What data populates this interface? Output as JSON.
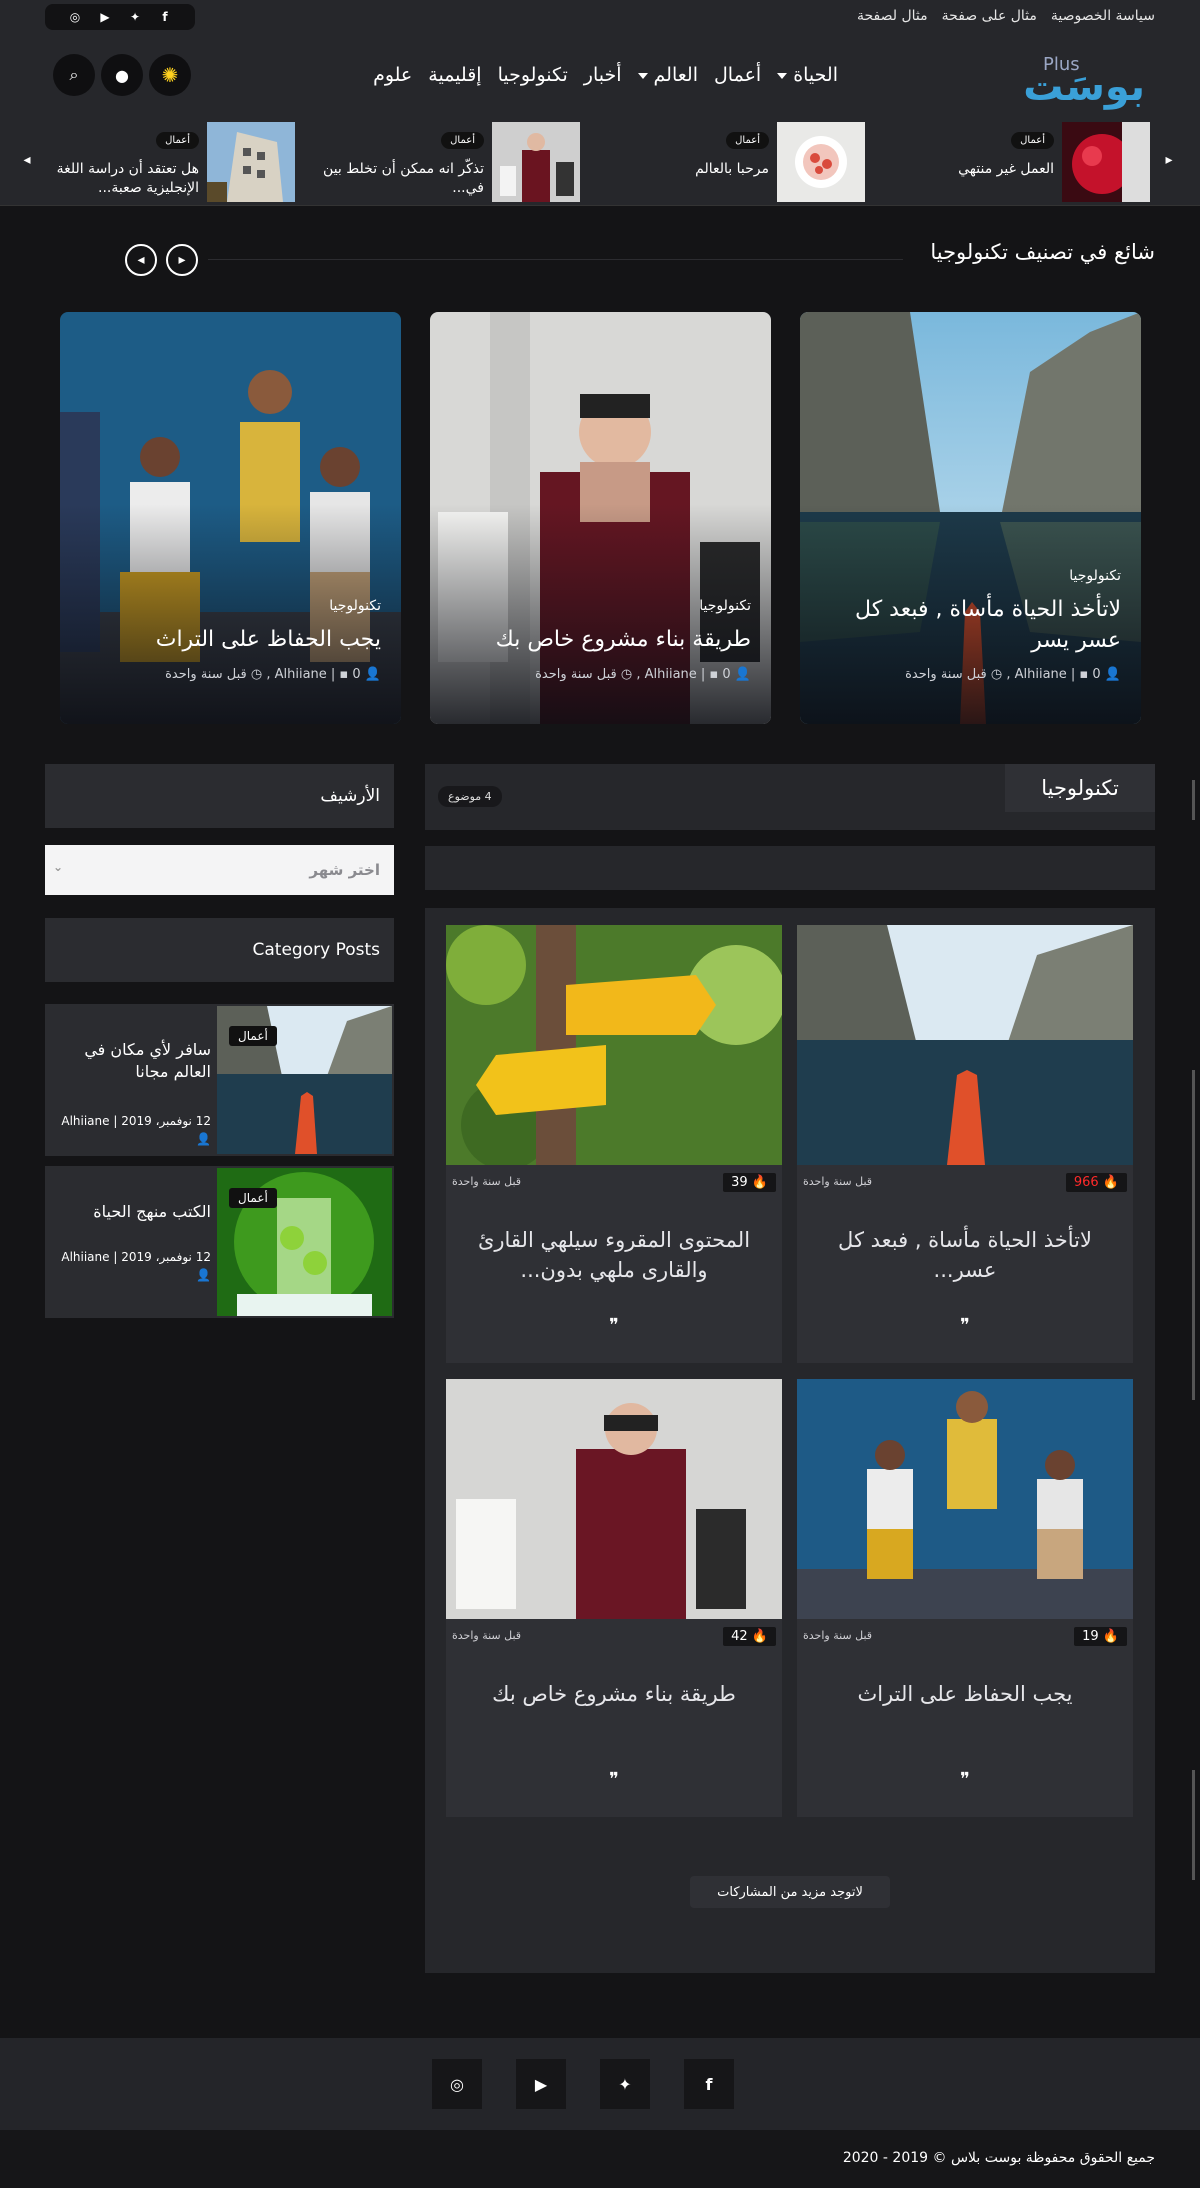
{
  "topbar": {
    "links": [
      "سياسة الخصوصية",
      "مثال على صفحة",
      "مثال لصفحة"
    ],
    "social_icons": [
      "facebook-icon",
      "twitter-icon",
      "youtube-icon",
      "instagram-icon"
    ]
  },
  "header": {
    "logo_text": "بوسَت",
    "logo_plus": "Plus",
    "nav": [
      "الحياة",
      "أعمال",
      "العالم",
      "أخبار",
      "تكنولوجيا",
      "إقليمية",
      "علوم"
    ],
    "buttons": [
      "theme-toggle-icon",
      "user-icon",
      "search-icon"
    ]
  },
  "ticker": {
    "items": [
      {
        "badge": "أعمال",
        "title": "العمل غير منتهي"
      },
      {
        "badge": "أعمال",
        "title": "مرحبا بالعالم"
      },
      {
        "badge": "أعمال",
        "title": "تذكّر انه ممكن أن تخلط بين في..."
      },
      {
        "badge": "أعمال",
        "title": "هل تعتقد أن دراسة اللغة الإنجليزية صعبة..."
      }
    ]
  },
  "trending": {
    "heading": "شائع في تصنيف تكنولوجيا",
    "cards": [
      {
        "category": "تكنولوجيا",
        "title": "لاتأخذ الحياة مأساة , فبعد كل عسر يسر",
        "author": "Alhiiane",
        "comments": "0",
        "time": "قبل سنة واحدة"
      },
      {
        "category": "تكنولوجيا",
        "title": "طريقة بناء مشروع خاص بك",
        "author": "Alhiiane",
        "comments": "0",
        "time": "قبل سنة واحدة"
      },
      {
        "category": "تكنولوجيا",
        "title": "يجب الحفاظ على التراث",
        "author": "Alhiiane",
        "comments": "0",
        "time": "قبل سنة واحدة"
      }
    ]
  },
  "category": {
    "title": "تكنولوجيا",
    "count": "4 موضوع",
    "posts": [
      {
        "views": "966",
        "hot": true,
        "time": "قبل سنة واحدة",
        "title": "لاتأخذ الحياة مأساة , فبعد كل عسر..."
      },
      {
        "views": "39",
        "hot": false,
        "time": "قبل سنة واحدة",
        "title": "المحتوى المقروء سيلهي القارئ والقارى ملهي بدون..."
      },
      {
        "views": "19",
        "hot": false,
        "time": "قبل سنة واحدة",
        "title": "يجب الحفاظ على التراث"
      },
      {
        "views": "42",
        "hot": false,
        "time": "قبل سنة واحدة",
        "title": "طريقة بناء مشروع خاص بك"
      }
    ],
    "no_more": "لاتوجد مزيد من المشاركات"
  },
  "sidebar": {
    "archive_title": "الأرشيف",
    "archive_select": "اختر شهر",
    "category_posts_title": "Category Posts",
    "posts": [
      {
        "badge": "أعمال",
        "title": "سافر لأي مكان في العالم مجانا",
        "date": "12 نوفمبر، 2019 | Alhiiane"
      },
      {
        "badge": "أعمال",
        "title": "الكتب منهج الحياة",
        "date": "12 نوفمبر، 2019 | Alhiiane"
      }
    ]
  },
  "footer": {
    "social_icons": [
      "facebook-icon",
      "twitter-icon",
      "youtube-icon",
      "instagram-icon"
    ],
    "copyright": "جميع الحقوق محفوظة بوست بلاس © 2019 - 2020"
  },
  "colors": {
    "background": "#141416",
    "panel": "#26272b",
    "card": "#2f3035",
    "accent": "#3aa0d8",
    "hot": "#ff2a2a"
  }
}
